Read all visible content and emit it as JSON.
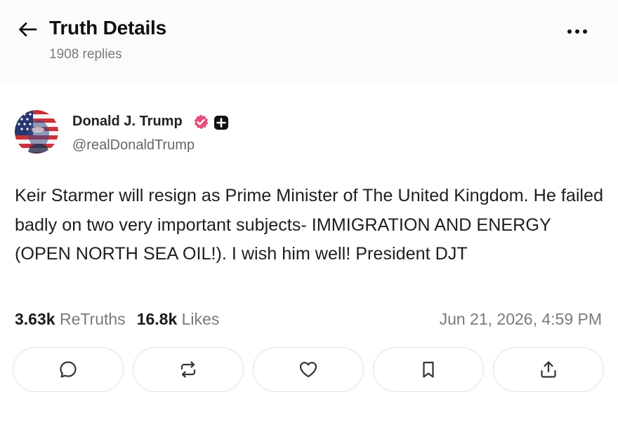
{
  "header": {
    "back_icon": "arrow-left-icon",
    "title": "Truth Details",
    "subtitle": "1908 replies",
    "more_icon": "more-horizontal-icon"
  },
  "post": {
    "author": {
      "name": "Donald J. Trump",
      "handle": "@realDonaldTrump",
      "avatar": "avatar-american-flag-portrait",
      "verified_icon": "verified-check-icon",
      "verified_color": "#e94d7a",
      "badge_icon": "plus-badge-icon"
    },
    "text": "Keir Starmer will resign as Prime Minister of The United Kingdom. He failed badly on two very important subjects- IMMIGRATION AND ENERGY (OPEN NORTH SEA OIL!). I wish him well! President DJT",
    "stats": {
      "retruths_count": "3.63k",
      "retruths_label": "ReTruths",
      "likes_count": "16.8k",
      "likes_label": "Likes"
    },
    "timestamp": "Jun 21, 2026, 4:59 PM"
  },
  "actions": [
    {
      "name": "reply",
      "icon": "comment-icon"
    },
    {
      "name": "retruth",
      "icon": "repost-icon"
    },
    {
      "name": "like",
      "icon": "heart-icon"
    },
    {
      "name": "bookmark",
      "icon": "bookmark-icon"
    },
    {
      "name": "share",
      "icon": "share-icon"
    }
  ]
}
